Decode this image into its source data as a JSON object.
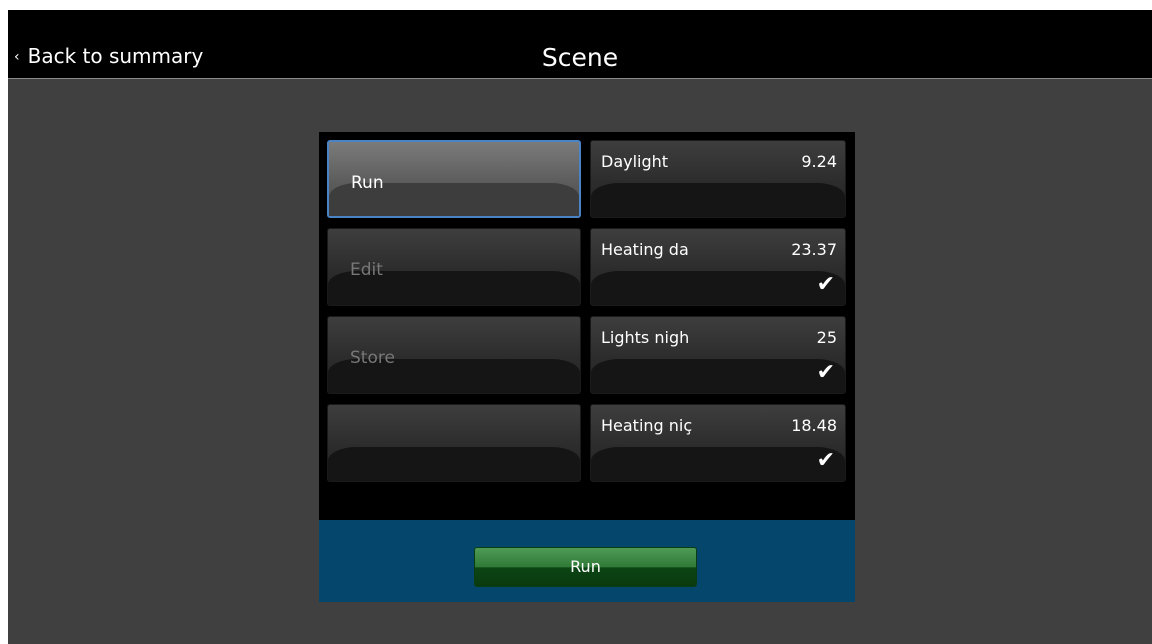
{
  "header": {
    "back_label": "Back to summary",
    "back_chevron": "‹",
    "title": "Scene"
  },
  "actions": [
    {
      "label": "Run",
      "state": "active"
    },
    {
      "label": "Edit",
      "state": "disabled"
    },
    {
      "label": "Store",
      "state": "disabled"
    },
    {
      "label": "",
      "state": "disabled"
    }
  ],
  "scenes": [
    {
      "name": "Daylight",
      "value": "9.24",
      "check": ""
    },
    {
      "name": "Heating da",
      "value": "23.37",
      "check": "✔"
    },
    {
      "name": "Lights nigh",
      "value": "25",
      "check": "✔"
    },
    {
      "name": "Heating niç",
      "value": "18.48",
      "check": "✔"
    }
  ],
  "footer": {
    "run_label": "Run"
  },
  "colors": {
    "header_bg": "#000000",
    "screen_bg": "#404040",
    "footer_bg": "#05466d",
    "active_border": "#4b84c4",
    "run_button": "#2f7a37"
  }
}
